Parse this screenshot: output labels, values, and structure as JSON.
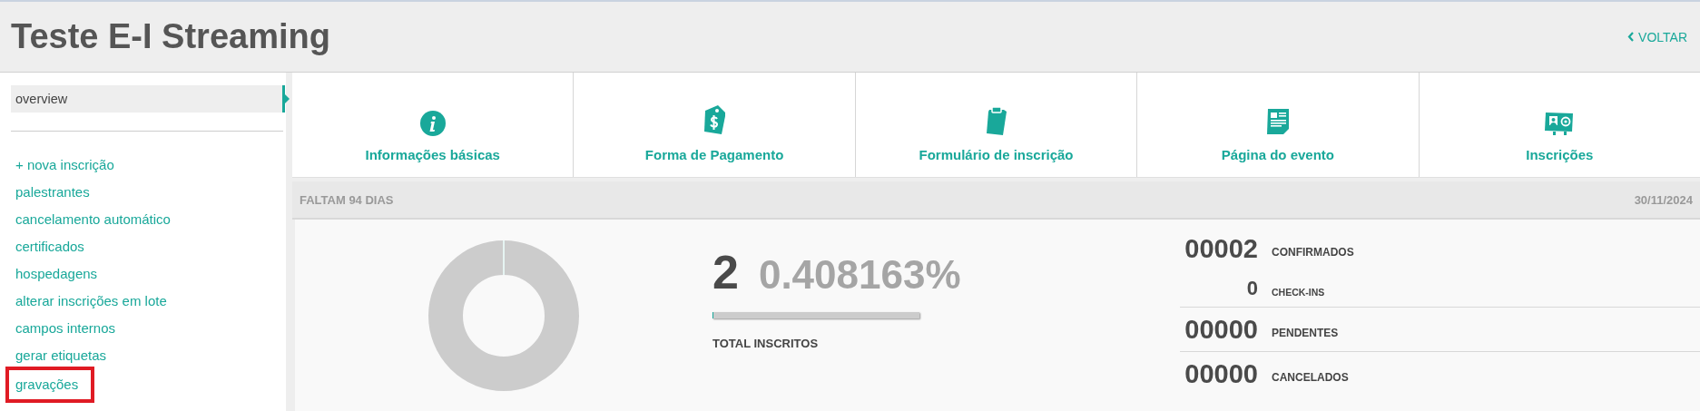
{
  "header": {
    "title": "Teste E-I Streaming",
    "back_link": "VOLTAR"
  },
  "sidebar": {
    "items": [
      {
        "label": "overview",
        "selected": true
      }
    ],
    "links": [
      {
        "label": "+ nova inscrição",
        "highlighted": false
      },
      {
        "label": "palestrantes",
        "highlighted": false
      },
      {
        "label": "cancelamento automático",
        "highlighted": false
      },
      {
        "label": "certificados",
        "highlighted": false
      },
      {
        "label": "hospedagens",
        "highlighted": false
      },
      {
        "label": "alterar inscrições em lote",
        "highlighted": false
      },
      {
        "label": "campos internos",
        "highlighted": false
      },
      {
        "label": "gerar etiquetas",
        "highlighted": false
      },
      {
        "label": "gravações",
        "highlighted": true
      }
    ]
  },
  "tiles": [
    {
      "label": "Informações básicas",
      "kind": "info"
    },
    {
      "label": "Forma de Pagamento",
      "kind": "tag"
    },
    {
      "label": "Formulário de inscrição",
      "kind": "clipboard"
    },
    {
      "label": "Página do evento",
      "kind": "page"
    },
    {
      "label": "Inscrições",
      "kind": "card"
    }
  ],
  "panel": {
    "countdown": "FALTAM 94 DIAS",
    "date": "30/11/2024",
    "total": {
      "count": "2",
      "percent": "0.408163%",
      "level": 0.004,
      "label": "TOTAL INSCRITOS"
    },
    "stats": [
      {
        "value": "00002",
        "label": "CONFIRMADOS",
        "kind": "main"
      },
      {
        "value": "0",
        "label": "CHECK-INS",
        "kind": "sub"
      },
      {
        "value": "00000",
        "label": "PENDENTES",
        "kind": "main"
      },
      {
        "value": "00000",
        "label": "CANCELADOS",
        "kind": "main"
      }
    ]
  }
}
